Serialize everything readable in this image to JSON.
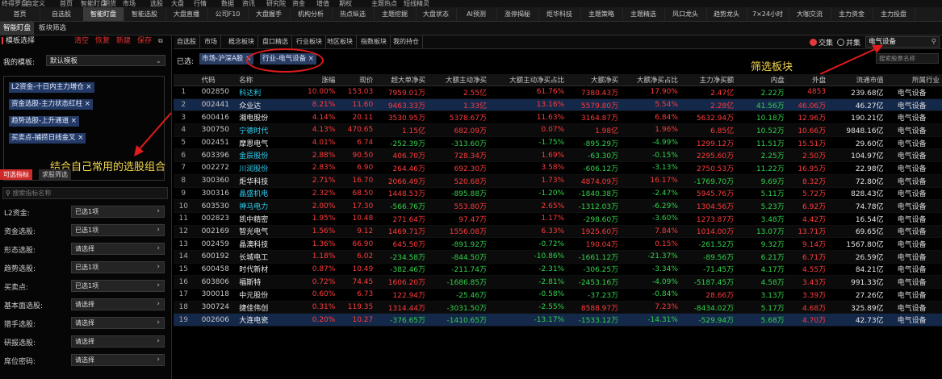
{
  "top_strip": [
    "终得罗盘",
    "自定义",
    "首页",
    "智能盯盘",
    "期货",
    "市场",
    "选股",
    "大盘",
    "行情",
    "数据",
    "资讯",
    "研究院",
    "资金",
    "增值",
    "期权",
    "主题热点",
    "短线精灵"
  ],
  "nav_tabs": [
    "首页",
    "自选股",
    "智能盯盘",
    "智能选股",
    "大盘直播",
    "公司F10",
    "大盘握手",
    "机构分析",
    "热点纵选",
    "主题挖掘",
    "大盘状态",
    "AI预测",
    "涨停揭秘",
    "炬华科技",
    "主题策略",
    "主题精选",
    "风口龙头",
    "趋势龙头",
    "7×24小时",
    "大咖交流",
    "主力资金",
    "主力投盘"
  ],
  "sub_tabs": [
    "智能盯盘",
    "板块筛选"
  ],
  "left_panel": {
    "title": "模板选择",
    "actions": [
      "清空",
      "恢复",
      "新建",
      "保存"
    ],
    "my_template_label": "我的模板:",
    "template_value": "默认模板",
    "chips": [
      "L2资金-十日内主力增仓 ×",
      "资金选股-主力状态红柱 ×",
      "趋势选股-上升通道 ×",
      "买卖点-捕捞日线金叉 ×"
    ],
    "annotation": "结合自己常用的选股组合",
    "filter_tabs": [
      "可选指标",
      "求股筛选"
    ],
    "search_placeholder": "搜索指标名称",
    "filters": [
      {
        "label": "L2资金:",
        "value": "已选1项"
      },
      {
        "label": "资金选股:",
        "value": "已选1项"
      },
      {
        "label": "形态选股:",
        "value": "请选择"
      },
      {
        "label": "趋势选股:",
        "value": "已选1项"
      },
      {
        "label": "买卖点:",
        "value": "已选1项"
      },
      {
        "label": "基本面选股:",
        "value": "请选择"
      },
      {
        "label": "猎手选股:",
        "value": "请选择"
      },
      {
        "label": "研报选股:",
        "value": "请选择"
      },
      {
        "label": "席位密码:",
        "value": "请选择"
      }
    ]
  },
  "filter_bar": [
    "自选股",
    "市场",
    "概念板块",
    "盘口精选",
    "行业板块",
    "地区板块",
    "指数板块",
    "我的持仓"
  ],
  "right_controls": {
    "intersection": "交集",
    "union": "并集",
    "search_value": "电气设备"
  },
  "selected": {
    "label": "已选:",
    "chips": [
      "市场-沪深A股 ×",
      "行业-电气设备 ×"
    ]
  },
  "annotation_right": "筛选板块",
  "stock_search_placeholder": "搜索股票名称",
  "table": {
    "columns": [
      "",
      "代码",
      "名称",
      "涨幅",
      "现价",
      "超大单净买",
      "大额主动净买",
      "大额主动净买占比",
      "大额净买",
      "大额净买占比",
      "主力净买额",
      "内盘",
      "外盘",
      "流通市值",
      "所属行业"
    ],
    "rows": [
      [
        "1",
        "002850",
        "科达利",
        "10.00%",
        "153.03",
        "7959.01万",
        "2.55亿",
        "61.76%",
        "7380.43万",
        "17.90%",
        "2.47亿",
        "2.22万",
        "4853",
        "239.68亿",
        "电气设备"
      ],
      [
        "2",
        "002441",
        "众业达",
        "8.21%",
        "11.60",
        "9463.33万",
        "1.33亿",
        "13.16%",
        "5579.80万",
        "5.54%",
        "2.28亿",
        "41.56万",
        "46.06万",
        "46.27亿",
        "电气设备"
      ],
      [
        "3",
        "600416",
        "湘电股份",
        "4.14%",
        "20.11",
        "3530.95万",
        "5378.67万",
        "11.63%",
        "3164.87万",
        "6.84%",
        "5632.94万",
        "10.18万",
        "12.96万",
        "190.21亿",
        "电气设备"
      ],
      [
        "4",
        "300750",
        "宁德时代",
        "4.13%",
        "470.65",
        "1.15亿",
        "682.09万",
        "0.07%",
        "1.98亿",
        "1.96%",
        "6.85亿",
        "10.52万",
        "10.66万",
        "9848.16亿",
        "电气设备"
      ],
      [
        "5",
        "002451",
        "摩恩电气",
        "4.01%",
        "6.74",
        "-252.39万",
        "-313.60万",
        "-1.75%",
        "-895.29万",
        "-4.99%",
        "1299.12万",
        "11.51万",
        "15.51万",
        "29.60亿",
        "电气设备"
      ],
      [
        "6",
        "603396",
        "金辰股份",
        "2.88%",
        "90.50",
        "406.70万",
        "728.34万",
        "1.69%",
        "-63.30万",
        "-0.15%",
        "2295.60万",
        "2.25万",
        "2.50万",
        "104.97亿",
        "电气设备"
      ],
      [
        "7",
        "002272",
        "川润股份",
        "2.83%",
        "6.90",
        "264.46万",
        "692.30万",
        "3.58%",
        "-606.12万",
        "-3.13%",
        "2750.53万",
        "11.22万",
        "16.95万",
        "22.98亿",
        "电气设备"
      ],
      [
        "8",
        "300360",
        "炬华科技",
        "2.71%",
        "16.70",
        "2066.49万",
        "520.68万",
        "1.73%",
        "4874.09万",
        "16.17%",
        "-1769.70万",
        "9.69万",
        "8.32万",
        "72.80亿",
        "电气设备"
      ],
      [
        "9",
        "300316",
        "晶盛机电",
        "2.32%",
        "68.50",
        "1448.53万",
        "-895.88万",
        "-1.20%",
        "-1840.38万",
        "-2.47%",
        "5945.76万",
        "5.11万",
        "5.72万",
        "828.43亿",
        "电气设备"
      ],
      [
        "10",
        "603530",
        "神马电力",
        "2.00%",
        "17.30",
        "-566.76万",
        "553.80万",
        "2.65%",
        "-1312.03万",
        "-6.29%",
        "1304.56万",
        "5.23万",
        "6.92万",
        "74.78亿",
        "电气设备"
      ],
      [
        "11",
        "002823",
        "凯中精密",
        "1.95%",
        "10.48",
        "271.64万",
        "97.47万",
        "1.17%",
        "-298.60万",
        "-3.60%",
        "1273.87万",
        "3.48万",
        "4.42万",
        "16.54亿",
        "电气设备"
      ],
      [
        "12",
        "002169",
        "智光电气",
        "1.56%",
        "9.12",
        "1469.71万",
        "1556.08万",
        "6.33%",
        "1925.60万",
        "7.84%",
        "1014.00万",
        "13.07万",
        "13.71万",
        "69.65亿",
        "电气设备"
      ],
      [
        "13",
        "002459",
        "晶澳科技",
        "1.36%",
        "66.90",
        "645.50万",
        "-891.92万",
        "-0.72%",
        "190.04万",
        "0.15%",
        "-261.52万",
        "9.32万",
        "9.14万",
        "1567.80亿",
        "电气设备"
      ],
      [
        "14",
        "600192",
        "长城电工",
        "1.18%",
        "6.02",
        "-234.58万",
        "-844.50万",
        "-10.86%",
        "-1661.12万",
        "-21.37%",
        "-89.56万",
        "6.21万",
        "6.71万",
        "26.59亿",
        "电气设备"
      ],
      [
        "15",
        "600458",
        "时代新材",
        "0.87%",
        "10.49",
        "-382.46万",
        "-211.74万",
        "-2.31%",
        "-306.25万",
        "-3.34%",
        "-71.45万",
        "4.17万",
        "4.55万",
        "84.21亿",
        "电气设备"
      ],
      [
        "16",
        "603806",
        "福斯特",
        "0.72%",
        "74.45",
        "1606.20万",
        "-1686.85万",
        "-2.81%",
        "-2453.16万",
        "-4.09%",
        "-5187.45万",
        "4.58万",
        "3.43万",
        "991.33亿",
        "电气设备"
      ],
      [
        "17",
        "300018",
        "中元股份",
        "0.60%",
        "6.73",
        "122.94万",
        "-25.46万",
        "-0.58%",
        "-37.23万",
        "-0.84%",
        "28.66万",
        "3.13万",
        "3.39万",
        "27.26亿",
        "电气设备"
      ],
      [
        "18",
        "300724",
        "捷佳伟创",
        "0.31%",
        "119.35",
        "1314.44万",
        "-3031.50万",
        "-2.55%",
        "8588.97万",
        "7.23%",
        "-8434.02万",
        "5.17万",
        "4.68万",
        "325.89亿",
        "电气设备"
      ],
      [
        "19",
        "002606",
        "大连电瓷",
        "0.20%",
        "10.27",
        "-376.65万",
        "-1410.65万",
        "-13.17%",
        "-1533.12万",
        "-14.31%",
        "-529.94万",
        "5.68万",
        "4.70万",
        "42.73亿",
        "电气设备"
      ]
    ]
  },
  "colors": {
    "up": "#ff3b3b",
    "down": "#32d24a",
    "accent": "#e23b3b",
    "chip": "#243a66",
    "annotation": "#f2d64a",
    "highlight": "#14284a"
  }
}
